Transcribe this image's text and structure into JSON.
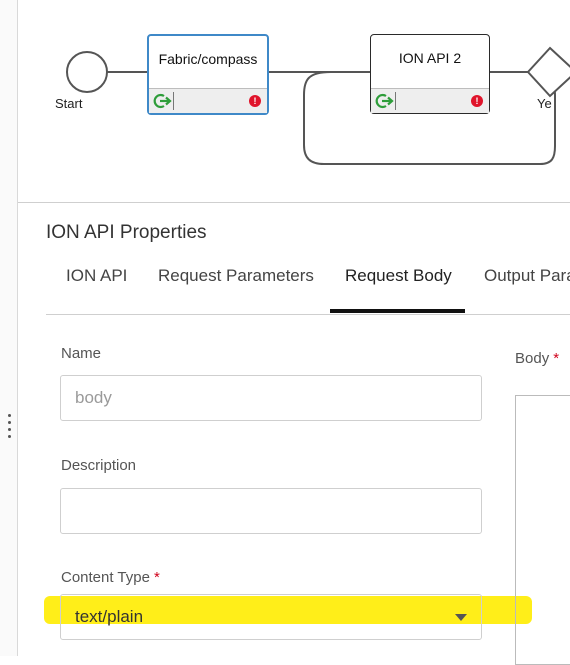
{
  "workflow": {
    "start_label": "Start",
    "yes_label": "Ye",
    "nodes": [
      {
        "title": "Fabric/compass",
        "selected": true
      },
      {
        "title": "ION API 2",
        "selected": false
      }
    ]
  },
  "panel": {
    "title": "ION API Properties",
    "tabs": [
      {
        "label": "ION API",
        "active": false
      },
      {
        "label": "Request Parameters",
        "active": false
      },
      {
        "label": "Request Body",
        "active": true
      },
      {
        "label": "Output Para",
        "active": false
      }
    ]
  },
  "form": {
    "name": {
      "label": "Name",
      "placeholder": "body",
      "value": ""
    },
    "description": {
      "label": "Description",
      "value": ""
    },
    "content_type": {
      "label": "Content Type",
      "required_mark": "*",
      "value": "text/plain"
    },
    "body": {
      "label": "Body",
      "required_mark": "*"
    }
  },
  "colors": {
    "selected_border": "#3f89c8",
    "error_badge": "#e0142b",
    "highlight": "#ffec00",
    "required": "#d0021b"
  }
}
